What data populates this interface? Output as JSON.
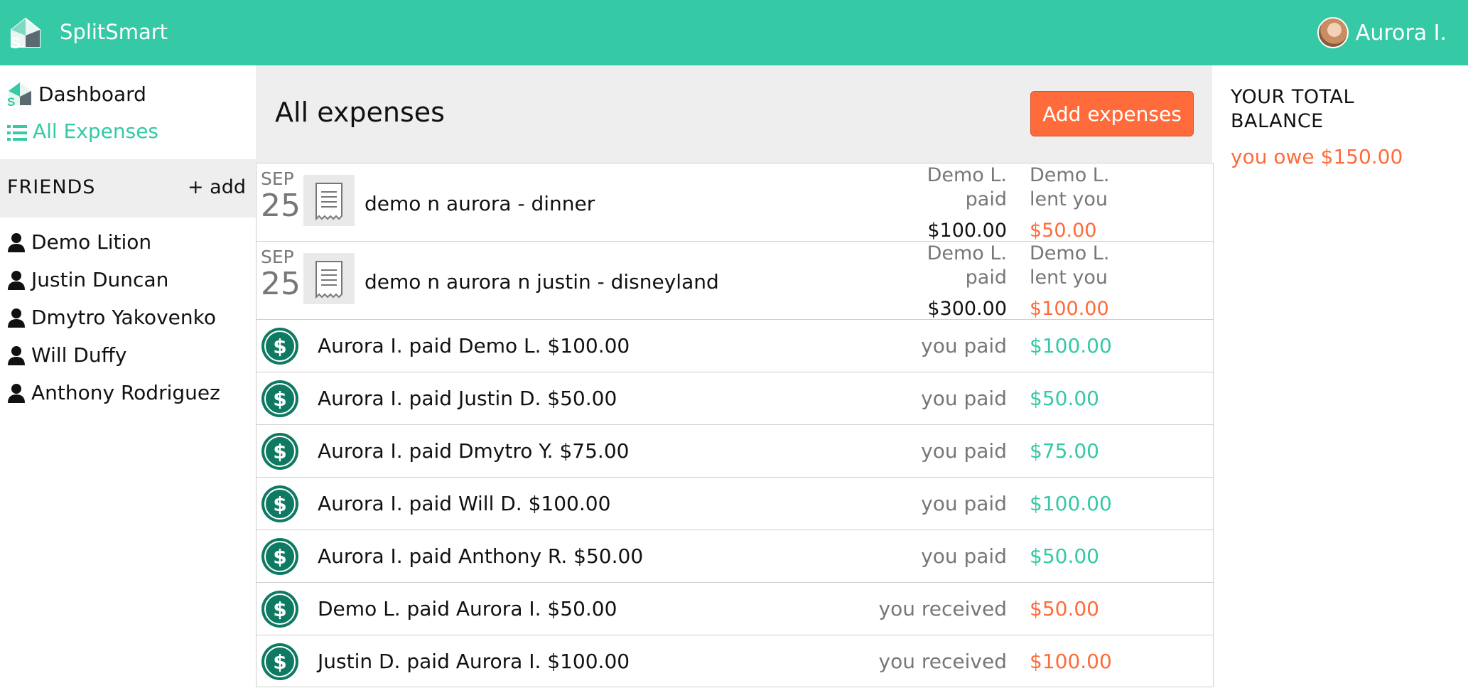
{
  "app": {
    "name": "SplitSmart"
  },
  "user": {
    "name": "Aurora I."
  },
  "colors": {
    "brand": "#35c9a5",
    "accent": "#ff6b3a"
  },
  "sidebar": {
    "nav": [
      {
        "label": "Dashboard",
        "icon": "splitsmart-logo-icon"
      },
      {
        "label": "All Expenses",
        "icon": "list-icon"
      }
    ],
    "friends_title": "FRIENDS",
    "friends_add": "+ add",
    "friends": [
      "Demo Lition",
      "Justin Duncan",
      "Dmytro Yakovenko",
      "Will Duffy",
      "Anthony Rodriguez"
    ]
  },
  "main": {
    "title": "All expenses",
    "add_button": "Add expenses",
    "expenses": [
      {
        "month": "SEP",
        "day": "25",
        "description": "demo n aurora - dinner",
        "payer_line1": "Demo L.",
        "payer_line2": "paid",
        "paid_amount": "$100.00",
        "lent_line1": "Demo L.",
        "lent_line2": "lent you",
        "lent_amount": "$50.00"
      },
      {
        "month": "SEP",
        "day": "25",
        "description": "demo n aurora n justin - disneyland",
        "payer_line1": "Demo L.",
        "payer_line2": "paid",
        "paid_amount": "$300.00",
        "lent_line1": "Demo L.",
        "lent_line2": "lent you",
        "lent_amount": "$100.00"
      }
    ],
    "payments": [
      {
        "description": "Aurora I. paid Demo L. $100.00",
        "label": "you paid",
        "amount": "$100.00",
        "type": "paid"
      },
      {
        "description": "Aurora I. paid Justin D. $50.00",
        "label": "you paid",
        "amount": "$50.00",
        "type": "paid"
      },
      {
        "description": "Aurora I. paid Dmytro Y. $75.00",
        "label": "you paid",
        "amount": "$75.00",
        "type": "paid"
      },
      {
        "description": "Aurora I. paid Will D. $100.00",
        "label": "you paid",
        "amount": "$100.00",
        "type": "paid"
      },
      {
        "description": "Aurora I. paid Anthony R. $50.00",
        "label": "you paid",
        "amount": "$50.00",
        "type": "paid"
      },
      {
        "description": "Demo L. paid Aurora I. $50.00",
        "label": "you received",
        "amount": "$50.00",
        "type": "received"
      },
      {
        "description": "Justin D. paid Aurora I. $100.00",
        "label": "you received",
        "amount": "$100.00",
        "type": "received"
      }
    ]
  },
  "balance": {
    "title_line1": "YOUR TOTAL",
    "title_line2": "BALANCE",
    "value": "you owe $150.00"
  }
}
